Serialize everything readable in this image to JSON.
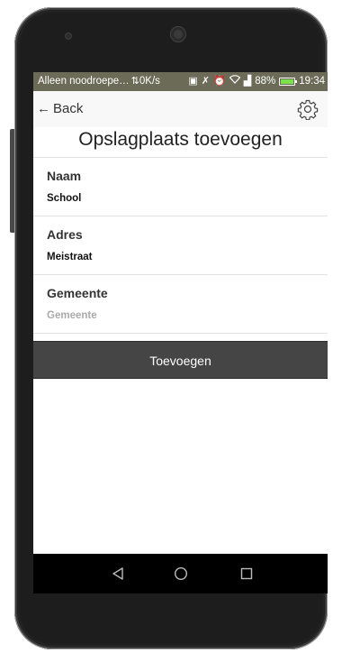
{
  "statusbar": {
    "carrier": "Alleen noodroepe…",
    "network_speed": "0K/s",
    "battery_percent": "88%",
    "time": "19:34",
    "battery_level": 0.88
  },
  "topbar": {
    "back_label": "Back",
    "settings_icon": "gear-icon"
  },
  "page": {
    "title": "Opslagplaats toevoegen"
  },
  "form": {
    "naam": {
      "label": "Naam",
      "value": "School"
    },
    "adres": {
      "label": "Adres",
      "value": "Meistraat"
    },
    "gemeente": {
      "label": "Gemeente",
      "value": "",
      "placeholder": "Gemeente"
    }
  },
  "actions": {
    "add_label": "Toevoegen"
  },
  "colors": {
    "statusbar": "#6b6b57",
    "button": "#454545",
    "battery_fill": "#7be34a"
  }
}
